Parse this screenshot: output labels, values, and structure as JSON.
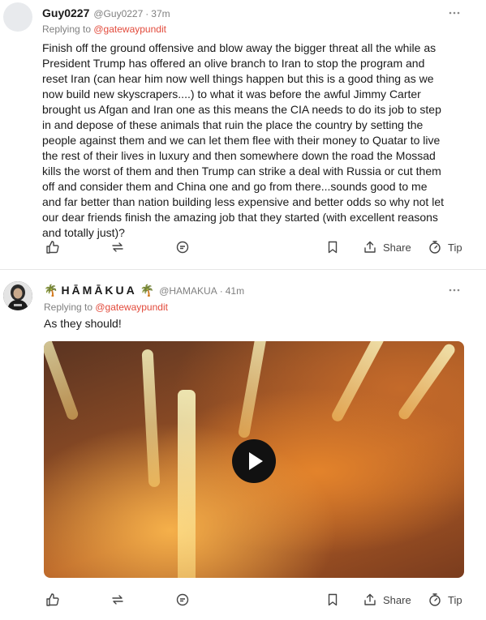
{
  "comments": [
    {
      "author": "Guy0227",
      "handle": "@Guy0227",
      "time": "37m",
      "replying_prefix": "Replying to ",
      "replying_to": "@gatewaypundit",
      "text": "Finish off the ground offensive and blow away the bigger threat all the while as President Trump has offered an olive branch to Iran to stop the program and reset Iran (can hear him now well things happen but this is a good thing as we now build new skyscrapers....) to what it was before the awful Jimmy Carter brought us Afgan and Iran one as this means the CIA needs to do its job to step in and depose of these animals that ruin the place the country by setting the people against them and we can let them flee with their money to Quatar to live the rest of their lives in luxury and then somewhere down the road the Mossad kills the worst of them and then Trump can strike a deal with Russia or cut them off and consider them and China one and go from there...sounds good to me and far better than nation building less expensive and better odds so why not let our dear friends finish the amazing job that they started (with excellent reasons and totally just)?",
      "actions": {
        "share": "Share",
        "tip": "Tip"
      }
    },
    {
      "author": "HĀMĀKUA",
      "author_emoji": "🌴",
      "handle": "@HAMAKUA",
      "time": "41m",
      "replying_prefix": "Replying to ",
      "replying_to": "@gatewaypundit",
      "text": "As they should!",
      "actions": {
        "share": "Share",
        "tip": "Tip"
      }
    }
  ],
  "icons": [
    "like-icon",
    "restack-icon",
    "comment-icon",
    "bookmark-icon",
    "share-icon",
    "tip-icon",
    "more-icon",
    "play-icon"
  ],
  "colors": {
    "link": "#e24a3b",
    "muted": "#808080",
    "text": "#1a1a1a"
  }
}
